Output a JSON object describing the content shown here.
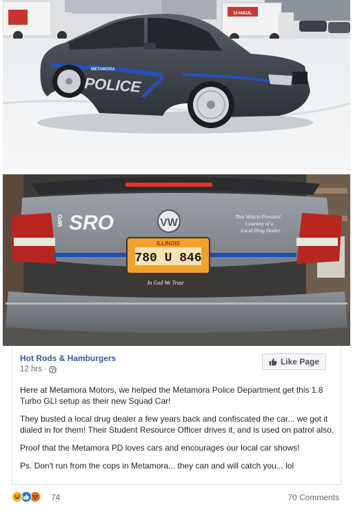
{
  "photos": [
    {
      "door_text_top": "METAMORA",
      "door_text_main": "POLICE",
      "truck_brand": "U-HAUL"
    },
    {
      "trunk_badge": "SRO",
      "trunk_badge_prefix": "MPD",
      "trunk_notice": [
        "This Vehicle Provided",
        "Courtesy of a",
        "Local Drug Dealer"
      ],
      "plate_state": "ILLINOIS",
      "plate_number": "780 U 846",
      "bumper_motto": "In God We Trust",
      "brand_logo": "vw-logo"
    }
  ],
  "post": {
    "page_name": "Hot Rods & Hamburgers",
    "time": "12 hrs",
    "separator": "·",
    "privacy_icon": "globe-icon",
    "like_button_label": "Like Page",
    "paragraphs": [
      "Here at Metamora Motors, we helped the Metamora Police Department get this 1.8 Turbo GLI setup as their new Squad Car!",
      "They busted a local drug dealer a few years back and confiscated the car... we got it dialed in for them! Their Student Resource Officer drives it, and is used on patrol also.",
      "Proof that the Metamora PD loves cars and encourages our local car shows!",
      "Ps. Don't run from the cops in Metamora... they can and will catch you... lol"
    ]
  },
  "reactions": {
    "icons": [
      "haha-icon",
      "like-icon",
      "angry-icon"
    ],
    "colors": {
      "haha": "#f7b125",
      "like": "#1877f2",
      "angry": "#e9710f"
    },
    "count": "74",
    "comments": "70 Comments"
  }
}
